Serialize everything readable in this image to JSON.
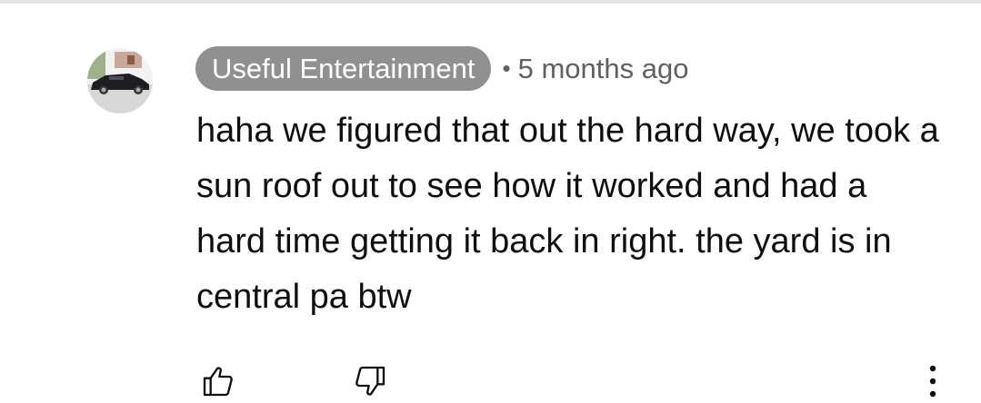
{
  "comment": {
    "author": "Useful Entertainment",
    "separator": "•",
    "timestamp": "5 months ago",
    "text": "haha we figured that out the hard way, we took a sun roof out to see how it worked and had a hard time getting it back in right. the yard is in central pa btw",
    "avatar_icon": "car-avatar-icon",
    "actions": {
      "like_icon": "thumbs-up-icon",
      "dislike_icon": "thumbs-down-icon",
      "menu_icon": "more-vert-icon"
    }
  },
  "colors": {
    "author_chip_bg": "#909090",
    "author_chip_text": "#ffffff",
    "meta_text": "#606060",
    "body_text": "#0f0f0f",
    "divider": "#e5e5e5"
  }
}
